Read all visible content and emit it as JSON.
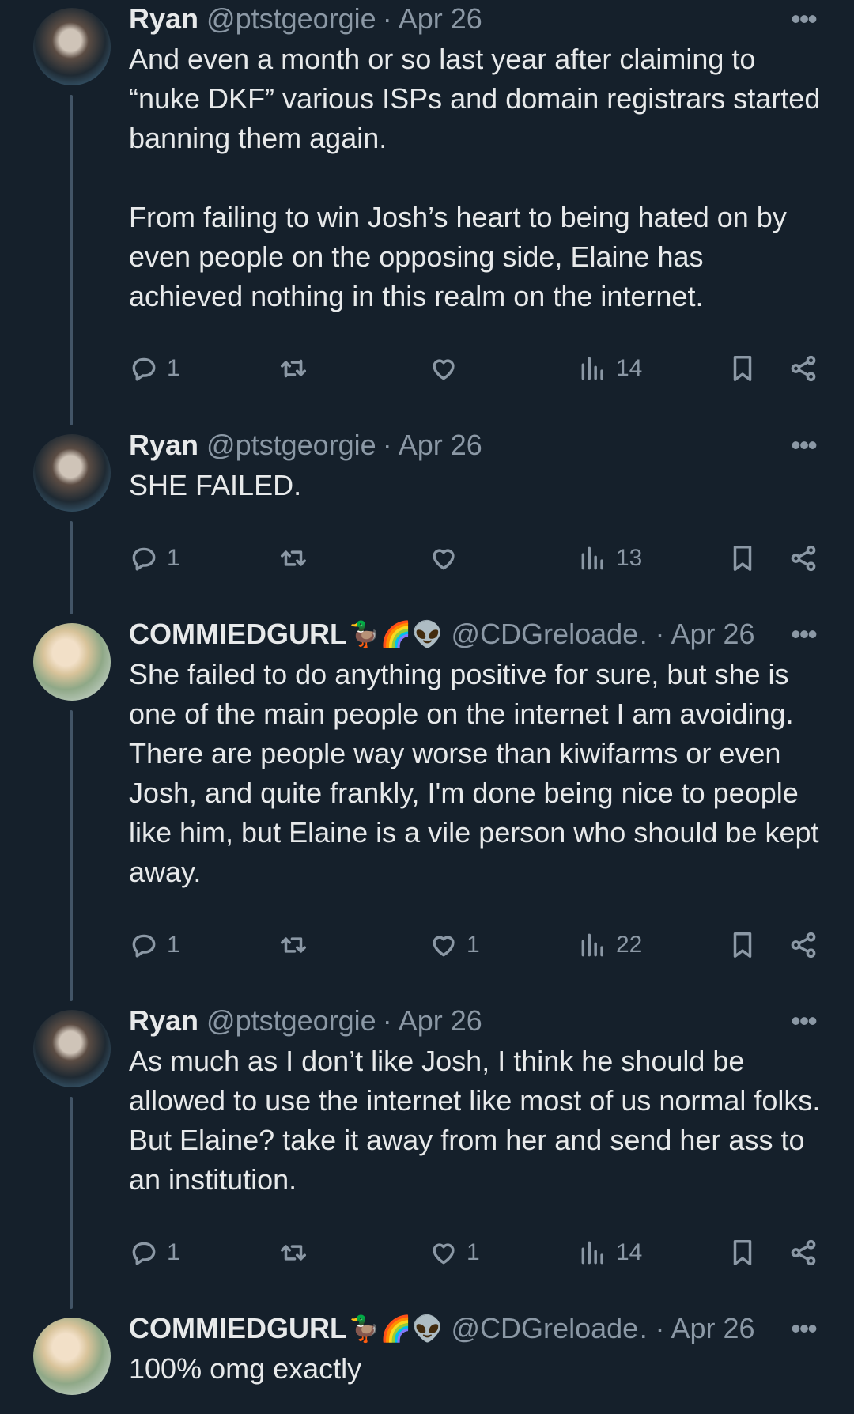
{
  "tweets": [
    {
      "name": "Ryan",
      "emojis": "",
      "handle": "@ptstgeorgie",
      "date": "Apr 26",
      "text": "And even a month or so last year after claiming to “nuke DKF” various ISPs and domain registrars started banning them again.\n\nFrom failing to win Josh’s heart to being hated on by even people on the opposing side, Elaine has achieved nothing in this realm on the internet.",
      "replies": "1",
      "retweets": "",
      "likes": "",
      "views": "14"
    },
    {
      "name": "Ryan",
      "emojis": "",
      "handle": "@ptstgeorgie",
      "date": "Apr 26",
      "text": "SHE FAILED.",
      "replies": "1",
      "retweets": "",
      "likes": "",
      "views": "13"
    },
    {
      "name": "COMMIEDGURL",
      "emojis": "🦆🌈👽",
      "handle": "@CDGreloade…",
      "date": "Apr 26",
      "text": "She failed to do anything positive for sure, but she is one of the main people on the internet I am avoiding. There are people way worse than kiwifarms or even Josh, and quite frankly, I'm done being nice to people like him, but Elaine is a vile person who should be kept away.",
      "replies": "1",
      "retweets": "",
      "likes": "1",
      "views": "22"
    },
    {
      "name": "Ryan",
      "emojis": "",
      "handle": "@ptstgeorgie",
      "date": "Apr 26",
      "text": "As much as I don’t like Josh, I think he should be allowed to use the internet like most of us normal folks. But Elaine? take it away from her and send her ass to an institution.",
      "replies": "1",
      "retweets": "",
      "likes": "1",
      "views": "14"
    },
    {
      "name": "COMMIEDGURL",
      "emojis": "🦆🌈👽",
      "handle": "@CDGreloade…",
      "date": "Apr 26",
      "text": "100% omg exactly"
    }
  ],
  "icons": {
    "reply": "reply-icon",
    "retweet": "retweet-icon",
    "like": "heart-icon",
    "views": "views-icon",
    "bookmark": "bookmark-icon",
    "share": "share-icon",
    "more": "more-icon"
  },
  "colors": {
    "background": "#15202b",
    "text": "#e7e9ea",
    "muted": "#8b98a5",
    "thread_line": "#425466"
  }
}
